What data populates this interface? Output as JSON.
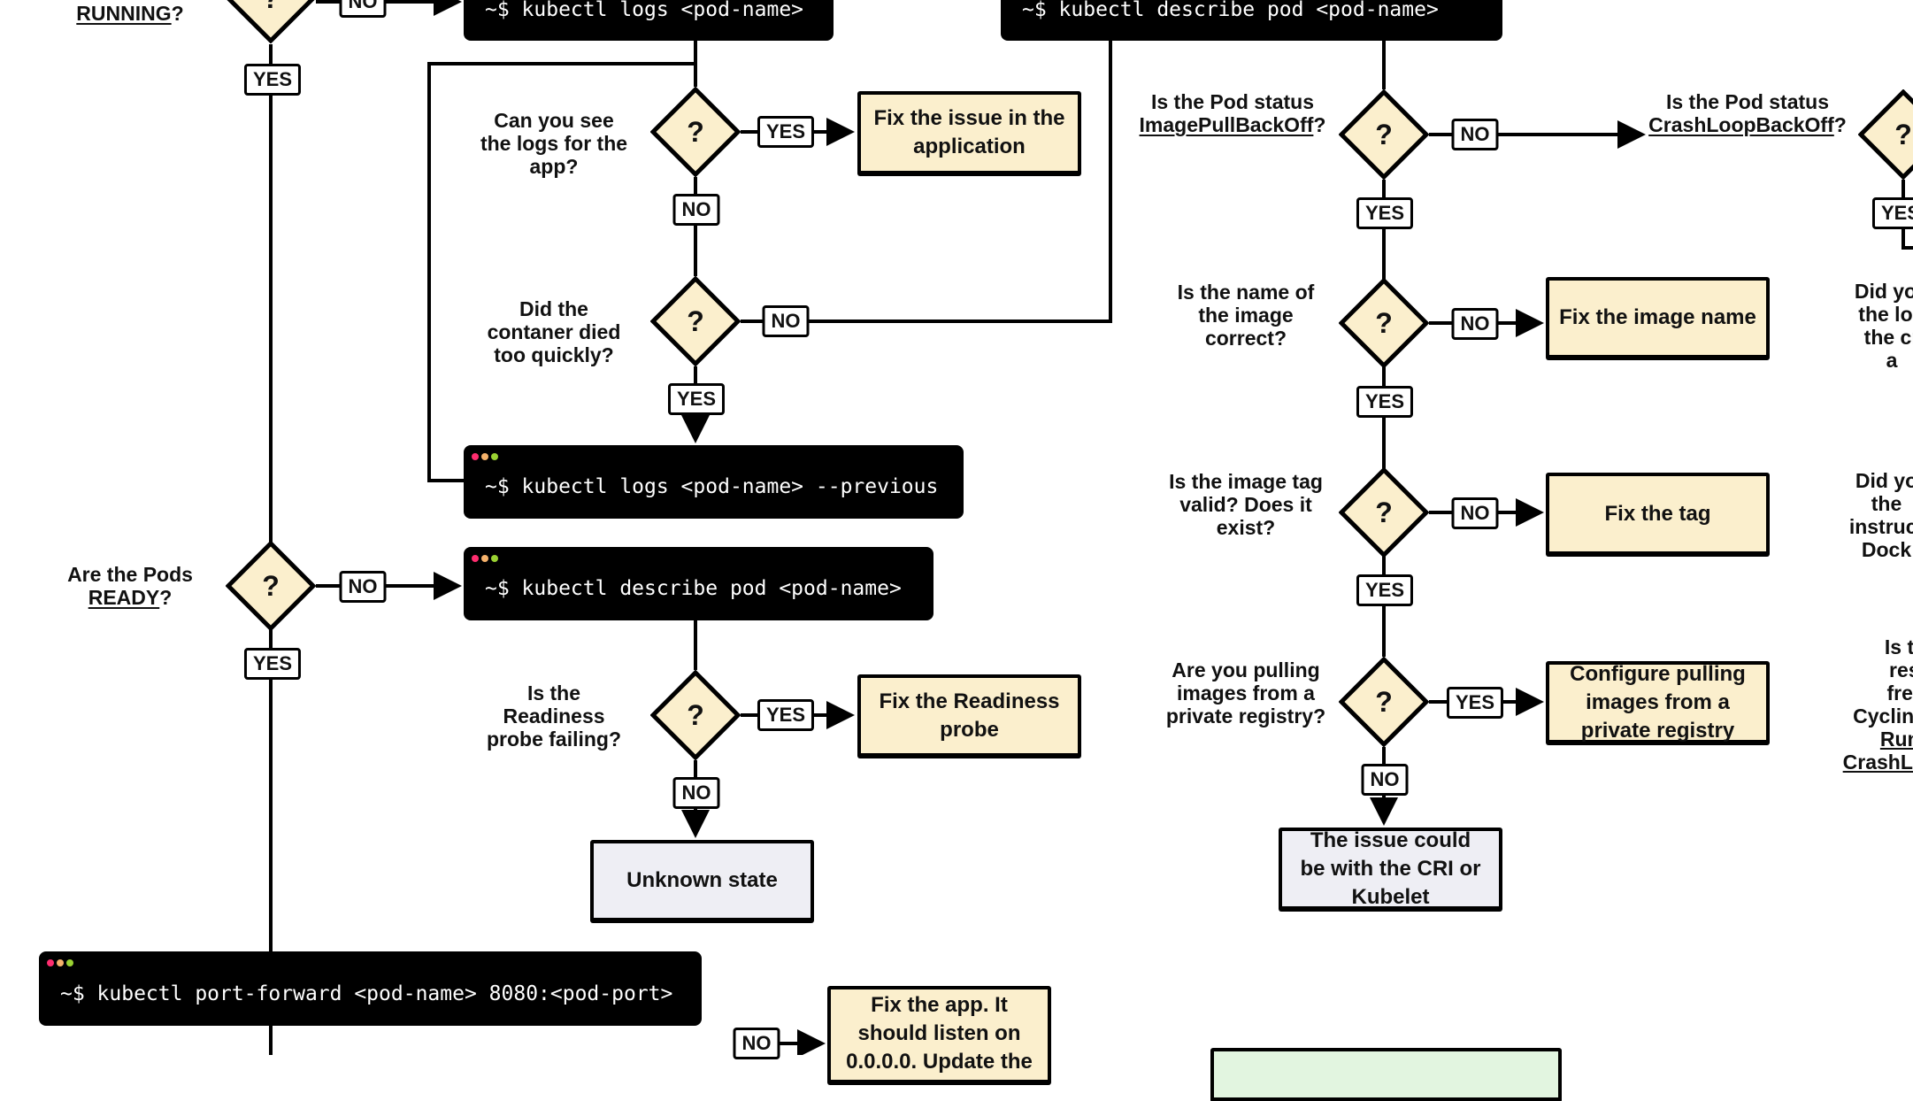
{
  "colors": {
    "decision_fill": "#fbefcd",
    "fix_box_fill": "#fbefcd",
    "terminal_bg": "#000000",
    "unknown_box_fill": "#eeeef4",
    "partial_box_fill": "#e2f5e0",
    "dot_red": "#ff2d6f",
    "dot_yellow": "#f6b26b",
    "dot_green": "#9ad232"
  },
  "decision_symbol": "?",
  "labels": {
    "yes": "YES",
    "no": "NO"
  },
  "questions": {
    "running": {
      "pre": "",
      "underlined": "RUNNING",
      "post": "?"
    },
    "see_logs": {
      "lines": [
        "Can you see",
        "the logs for the",
        "app?"
      ]
    },
    "died_quickly": {
      "lines": [
        "Did the",
        "contaner died",
        "too quickly?"
      ]
    },
    "ready": {
      "line1": "Are the Pods",
      "underlined": "READY",
      "post": "?"
    },
    "readiness_probe": {
      "lines": [
        "Is the",
        "Readiness",
        "probe failing?"
      ]
    },
    "image_pull": {
      "line1": "Is the Pod status",
      "underlined": "ImagePullBackOff",
      "post": "?"
    },
    "crash_loop": {
      "line1": "Is the Pod status",
      "underlined": "CrashLoopBackOff",
      "post": "?"
    },
    "image_name": {
      "lines": [
        "Is the name of",
        "the image",
        "correct?"
      ]
    },
    "image_tag": {
      "lines": [
        "Is the image tag",
        "valid? Does it",
        "exist?"
      ]
    },
    "private_registry": {
      "lines": [
        "Are you pulling",
        "images from a",
        "private registry?"
      ]
    },
    "right_1": {
      "lines": [
        "Did you",
        "the log",
        "the cr",
        "a"
      ]
    },
    "right_2": {
      "lines": [
        "Did yo",
        "the",
        "instruct",
        "Dock"
      ]
    },
    "right_3": {
      "lines": [
        "Is the",
        "resta",
        "frequ",
        "Cycling I"
      ],
      "underlined": [
        "Runni",
        "CrashLoo"
      ]
    }
  },
  "terminals": {
    "logs": "~$ kubectl logs <pod-name>",
    "describe_top": "~$ kubectl describe pod <pod-name>",
    "logs_previous": "~$ kubectl logs <pod-name> --previous",
    "describe_ready": "~$ kubectl describe pod <pod-name>",
    "port_forward": "~$ kubectl port-forward <pod-name> 8080:<pod-port>"
  },
  "outcomes": {
    "fix_app_issue": "Fix the issue in the application",
    "fix_readiness": "Fix the Readiness probe",
    "unknown_state": "Unknown state",
    "fix_image_name": "Fix the image name",
    "fix_tag": "Fix the tag",
    "configure_private": "Configure pulling images from a private registry",
    "cri_kubelet": "The issue could be with the CRI or Kubelet",
    "fix_app_listen": [
      "Fix the app. It",
      "should listen on",
      "0.0.0.0. Update the"
    ]
  }
}
